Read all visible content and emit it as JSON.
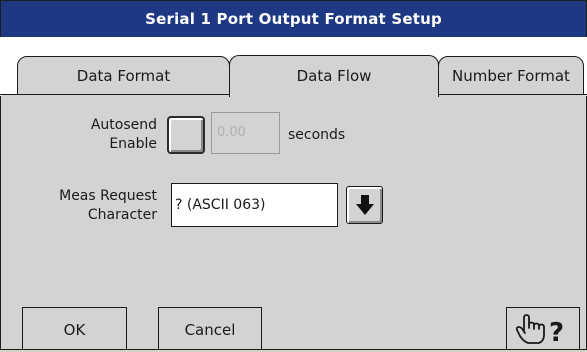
{
  "window": {
    "title": "Serial 1 Port Output Format Setup"
  },
  "tabs": [
    {
      "label": "Data Format",
      "active": false
    },
    {
      "label": "Data Flow",
      "active": true
    },
    {
      "label": "Number Format",
      "active": false
    }
  ],
  "autosend": {
    "label_line1": "Autosend",
    "label_line2": "Enable",
    "checked": false,
    "interval_value": "0.00",
    "interval_unit": "seconds"
  },
  "meas_request": {
    "label_line1": "Meas Request",
    "label_line2": "Character",
    "value": "? (ASCII 063)",
    "dropdown_icon": "arrow-down-icon"
  },
  "footer": {
    "ok_label": "OK",
    "cancel_label": "Cancel",
    "help_icon": "pointing-hand-question-icon"
  },
  "colors": {
    "title_bar": "#1f3884",
    "title_text": "#ffffff",
    "panel": "#d3d3d3",
    "tab_strip": "#ffffff"
  }
}
